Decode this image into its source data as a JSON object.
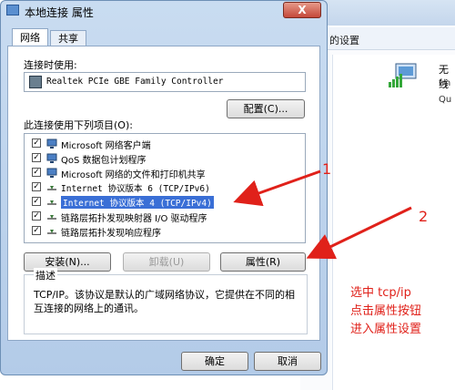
{
  "background": {
    "settings_text": "的设置",
    "network_name": "无线",
    "network_line2": "fm",
    "network_line3": "Qu"
  },
  "dialog": {
    "title": "本地连接 属性",
    "close_label": "X",
    "tabs": [
      {
        "label": "网络",
        "active": true
      },
      {
        "label": "共享",
        "active": false
      }
    ],
    "connect_using_label": "连接时使用:",
    "adapter_name": "Realtek PCIe GBE Family Controller",
    "configure_button": "配置(C)...",
    "items_label": "此连接使用下列项目(O):",
    "items": [
      {
        "label": "Microsoft 网络客户端",
        "checked": true,
        "icon": "network-client-icon"
      },
      {
        "label": "QoS 数据包计划程序",
        "checked": true,
        "icon": "qos-icon"
      },
      {
        "label": "Microsoft 网络的文件和打印机共享",
        "checked": true,
        "icon": "file-share-icon"
      },
      {
        "label": "Internet 协议版本 6 (TCP/IPv6)",
        "checked": true,
        "icon": "protocol-icon"
      },
      {
        "label": "Internet 协议版本 4 (TCP/IPv4)",
        "checked": true,
        "icon": "protocol-icon",
        "selected": true
      },
      {
        "label": "链路层拓扑发现映射器 I/O 驱动程序",
        "checked": true,
        "icon": "protocol-icon"
      },
      {
        "label": "链路层拓扑发现响应程序",
        "checked": true,
        "icon": "protocol-icon"
      }
    ],
    "install_button": "安装(N)...",
    "uninstall_button": "卸载(U)",
    "properties_button": "属性(R)",
    "description_title": "描述",
    "description_text": "TCP/IP。该协议是默认的广域网络协议，它提供在不同的相互连接的网络上的通讯。",
    "ok_button": "确定",
    "cancel_button": "取消"
  },
  "annotations": {
    "num1": "1",
    "num2": "2",
    "instructions": [
      "选中 tcp/ip",
      "点击属性按钮",
      "进入属性设置"
    ],
    "color": "#e0211a"
  }
}
